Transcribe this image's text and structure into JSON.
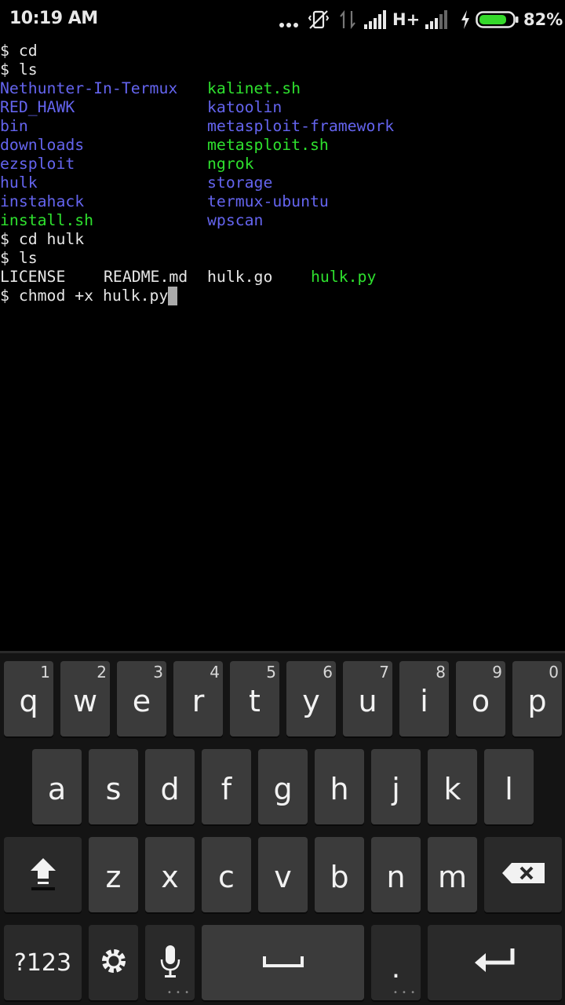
{
  "status_bar": {
    "time": "10:19 AM",
    "network_type": "H+",
    "battery_percent": "82%",
    "battery_level": 0.82,
    "icons": [
      "more-dots-icon",
      "vibrate-off-icon",
      "data-arrows-icon",
      "signal-icon",
      "signal-weak-icon",
      "charging-bolt-icon",
      "battery-icon"
    ]
  },
  "terminal": {
    "colors": {
      "directory": "#6464ee",
      "executable": "#2ee02e",
      "text": "#e6e6e6",
      "cursor": "#aaaaaa"
    },
    "line1": "$ cd",
    "line2": "$ ls",
    "ls_home": [
      [
        "Nethunter-In-Termux",
        "kalinet.sh"
      ],
      [
        "RED_HAWK",
        "katoolin"
      ],
      [
        "bin",
        "metasploit-framework"
      ],
      [
        "downloads",
        "metasploit.sh"
      ],
      [
        "ezsploit",
        "ngrok"
      ],
      [
        "hulk",
        "storage"
      ],
      [
        "instahack",
        "termux-ubuntu"
      ],
      [
        "install.sh",
        "wpscan"
      ]
    ],
    "line_cd_hulk": "$ cd hulk",
    "line_ls2": "$ ls",
    "ls_hulk": [
      "LICENSE",
      "README.md",
      "hulk.go",
      "hulk.py"
    ],
    "current_command": "$ chmod +x hulk.py"
  },
  "keyboard": {
    "row1": [
      {
        "label": "q",
        "hint": "1"
      },
      {
        "label": "w",
        "hint": "2"
      },
      {
        "label": "e",
        "hint": "3"
      },
      {
        "label": "r",
        "hint": "4"
      },
      {
        "label": "t",
        "hint": "5"
      },
      {
        "label": "y",
        "hint": "6"
      },
      {
        "label": "u",
        "hint": "7"
      },
      {
        "label": "i",
        "hint": "8"
      },
      {
        "label": "o",
        "hint": "9"
      },
      {
        "label": "p",
        "hint": "0"
      }
    ],
    "row2": [
      "a",
      "s",
      "d",
      "f",
      "g",
      "h",
      "j",
      "k",
      "l"
    ],
    "row3": [
      "z",
      "x",
      "c",
      "v",
      "b",
      "n",
      "m"
    ],
    "symbols_key": "?123",
    "period_key": ".",
    "special_icons": [
      "shift-icon",
      "backspace-icon",
      "settings-icon",
      "microphone-icon",
      "space-bar-icon",
      "enter-icon"
    ]
  }
}
